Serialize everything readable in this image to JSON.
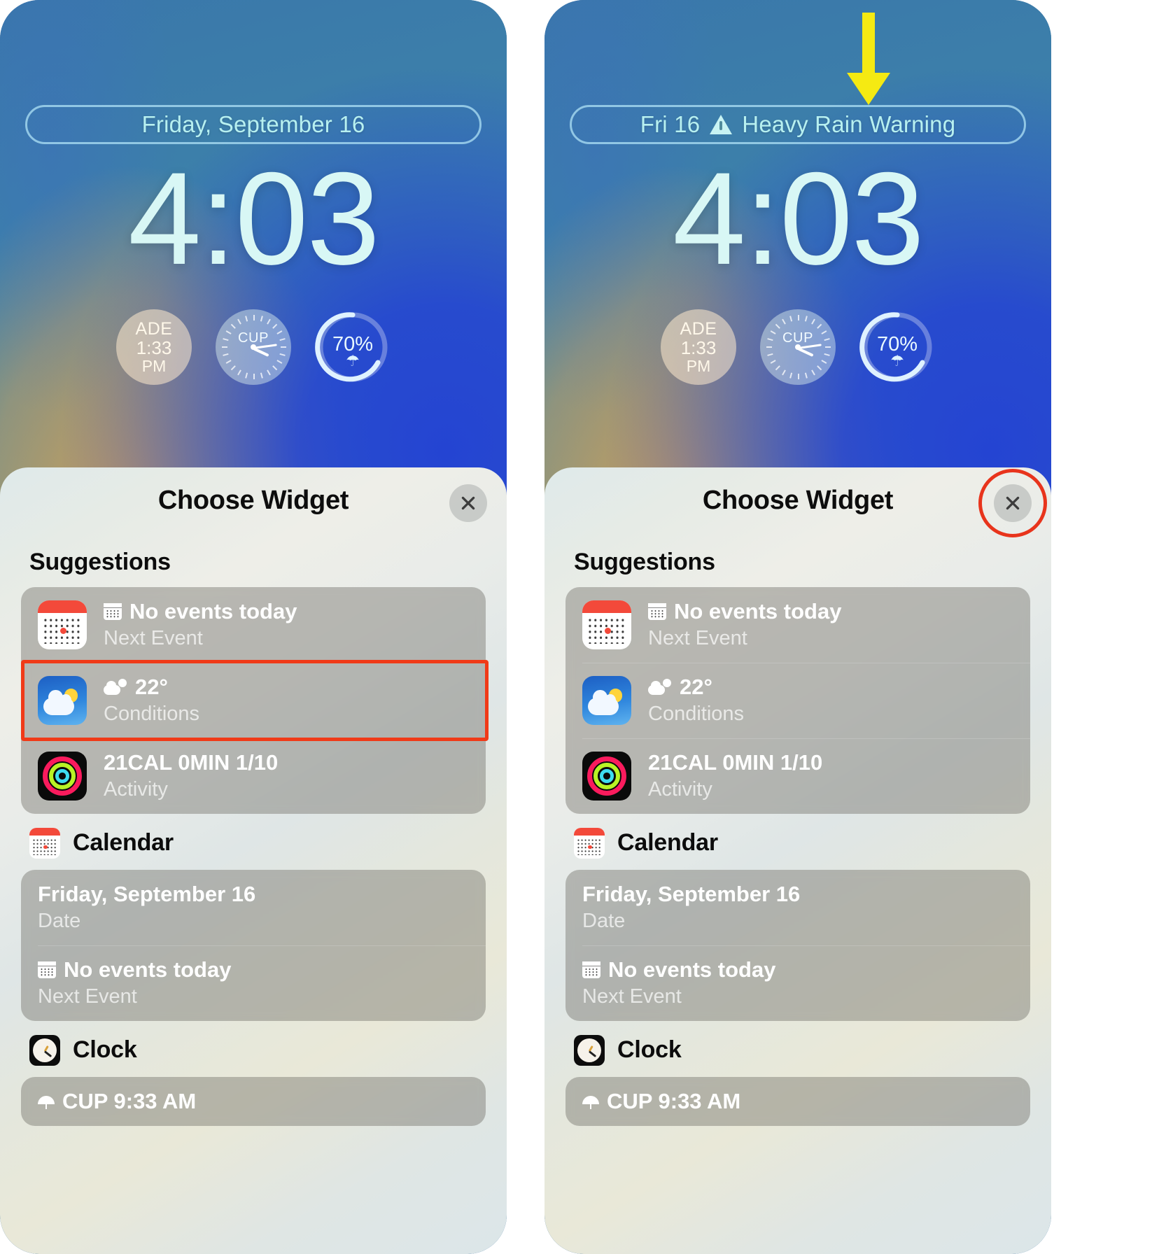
{
  "panels": [
    {
      "id": "left",
      "lock": {
        "date_pill": {
          "text": "Friday, September 16",
          "has_warning": false,
          "warning_text": ""
        },
        "clock": "4:03",
        "widgets": [
          {
            "name": "ade-reminder-widget",
            "line1": "ADE",
            "line2": "1:33",
            "line3": "PM"
          },
          {
            "name": "cup-clock-widget",
            "label": "CUP"
          },
          {
            "name": "rain-chance-widget",
            "value": "70%",
            "icon": "umbrella-icon"
          }
        ]
      },
      "sheet": {
        "title": "Choose Widget",
        "close_label": "close-icon",
        "close_highlighted": false,
        "sections": [
          {
            "label": "Suggestions",
            "kind": "label",
            "rows": [
              {
                "icon": "calendar-app-icon",
                "glyph": "calendar",
                "title": "No events today",
                "subtitle": "Next Event",
                "highlighted": false
              },
              {
                "icon": "weather-app-icon",
                "glyph": "weather",
                "title": "22°",
                "subtitle": "Conditions",
                "highlighted": true
              },
              {
                "icon": "activity-app-icon",
                "glyph": "none",
                "title": "21CAL 0MIN 1/10",
                "subtitle": "Activity",
                "highlighted": false
              }
            ]
          },
          {
            "label": "Calendar",
            "kind": "app",
            "app_icon": "calendar-app-icon",
            "rows": [
              {
                "icon": "none",
                "glyph": "none",
                "title": "Friday, September 16",
                "subtitle": "Date",
                "highlighted": false
              },
              {
                "icon": "none",
                "glyph": "calendar",
                "title": "No events today",
                "subtitle": "Next Event",
                "highlighted": false
              }
            ]
          },
          {
            "label": "Clock",
            "kind": "app",
            "app_icon": "clock-app-icon",
            "rows": [
              {
                "icon": "none",
                "glyph": "umbrella",
                "title": "CUP 9:33 AM",
                "subtitle": "",
                "highlighted": false
              }
            ]
          }
        ]
      },
      "annotations": {
        "arrow": false,
        "arrow_name": ""
      }
    },
    {
      "id": "right",
      "lock": {
        "date_pill": {
          "text": "Fri 16",
          "has_warning": true,
          "warning_text": "Heavy Rain Warning"
        },
        "clock": "4:03",
        "widgets": [
          {
            "name": "ade-reminder-widget",
            "line1": "ADE",
            "line2": "1:33",
            "line3": "PM"
          },
          {
            "name": "cup-clock-widget",
            "label": "CUP"
          },
          {
            "name": "rain-chance-widget",
            "value": "70%",
            "icon": "umbrella-icon"
          }
        ]
      },
      "sheet": {
        "title": "Choose Widget",
        "close_label": "close-icon",
        "close_highlighted": true,
        "sections": [
          {
            "label": "Suggestions",
            "kind": "label",
            "rows": [
              {
                "icon": "calendar-app-icon",
                "glyph": "calendar",
                "title": "No events today",
                "subtitle": "Next Event",
                "highlighted": false
              },
              {
                "icon": "weather-app-icon",
                "glyph": "weather",
                "title": "22°",
                "subtitle": "Conditions",
                "highlighted": false
              },
              {
                "icon": "activity-app-icon",
                "glyph": "none",
                "title": "21CAL 0MIN 1/10",
                "subtitle": "Activity",
                "highlighted": false
              }
            ]
          },
          {
            "label": "Calendar",
            "kind": "app",
            "app_icon": "calendar-app-icon",
            "rows": [
              {
                "icon": "none",
                "glyph": "none",
                "title": "Friday, September 16",
                "subtitle": "Date",
                "highlighted": false
              },
              {
                "icon": "none",
                "glyph": "calendar",
                "title": "No events today",
                "subtitle": "Next Event",
                "highlighted": false
              }
            ]
          },
          {
            "label": "Clock",
            "kind": "app",
            "app_icon": "clock-app-icon",
            "rows": [
              {
                "icon": "none",
                "glyph": "umbrella",
                "title": "CUP 9:33 AM",
                "subtitle": "",
                "highlighted": false
              }
            ]
          }
        ]
      },
      "annotations": {
        "arrow": true,
        "arrow_name": "yellow-down-arrow"
      }
    }
  ],
  "colors": {
    "highlight_red": "#f03a18",
    "arrow_yellow": "#f5ea12",
    "pill_text": "#b7f0f0",
    "clock_text": "#d8f7f5"
  }
}
